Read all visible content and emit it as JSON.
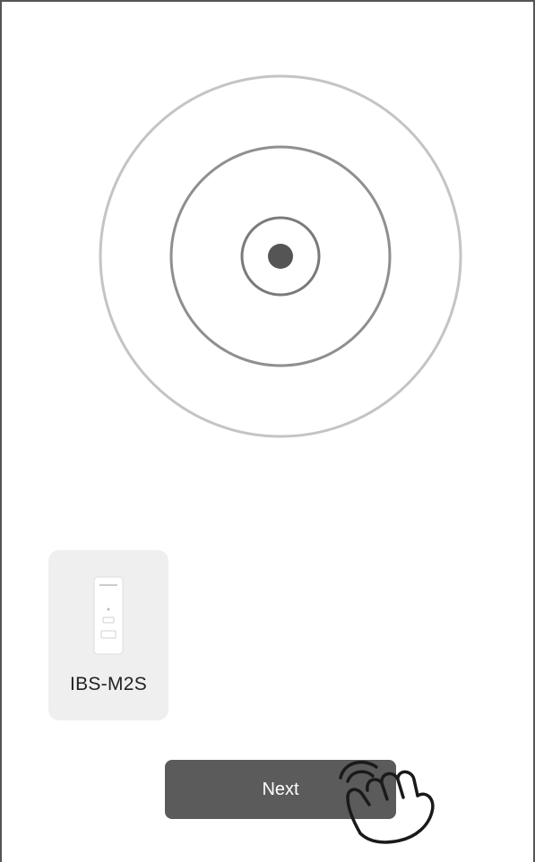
{
  "scan_animation": {
    "icon": "radar-scan-icon"
  },
  "device_list": {
    "items": [
      {
        "name": "IBS-M2S",
        "icon": "smart-switch-device-icon"
      }
    ]
  },
  "actions": {
    "next_label": "Next"
  },
  "hint": {
    "icon": "tap-hand-icon"
  },
  "colors": {
    "outer_ring": "#c4c4c4",
    "middle_ring": "#8f8f8f",
    "inner_ring": "#7a7a7a",
    "center_dot": "#555555",
    "card_background": "#efefef",
    "button_background": "#5b5b5b",
    "button_text": "#ffffff"
  }
}
